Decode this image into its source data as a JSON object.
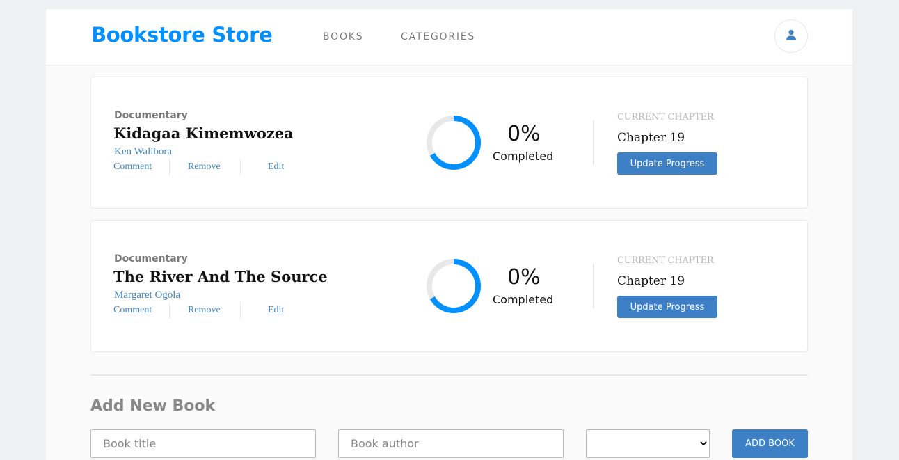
{
  "header": {
    "brand": "Bookstore Store",
    "nav": [
      "BOOKS",
      "CATEGORIES"
    ]
  },
  "books": [
    {
      "genre": "Documentary",
      "title": "Kidagaa Kimemwozea",
      "author": "Ken Walibora",
      "actions": [
        "Comment",
        "Remove",
        "Edit"
      ],
      "progress_percent": 0,
      "percent_label": "0%",
      "completed_label": "Completed",
      "current_chapter_label": "CURRENT CHAPTER",
      "chapter": "Chapter 19",
      "update_label": "Update Progress"
    },
    {
      "genre": "Documentary",
      "title": "The River And The Source",
      "author": "Margaret Ogola",
      "actions": [
        "Comment",
        "Remove",
        "Edit"
      ],
      "progress_percent": 0,
      "percent_label": "0%",
      "completed_label": "Completed",
      "current_chapter_label": "CURRENT CHAPTER",
      "chapter": "Chapter 19",
      "update_label": "Update Progress"
    }
  ],
  "form": {
    "title": "Add New Book",
    "title_placeholder": "Book title",
    "author_placeholder": "Book author",
    "category_value": "",
    "add_label": "ADD BOOK"
  },
  "colors": {
    "brand": "#0290ff",
    "button": "#3d80c6",
    "link": "#4386bf",
    "ring": "#0290ff",
    "ring_track": "#e8e8e8"
  },
  "icons": {
    "user": "user-icon"
  }
}
